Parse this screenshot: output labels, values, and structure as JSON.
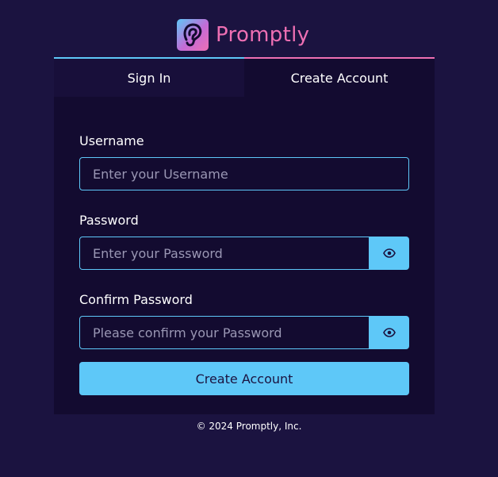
{
  "brand": {
    "name": "Promptly",
    "logo_icon": "ear-icon",
    "colors": {
      "pink": "#ee6fb3",
      "blue": "#5ec8f8",
      "background": "#1b1340",
      "card": "#130b30"
    }
  },
  "tabs": [
    {
      "label": "Sign In",
      "active": false
    },
    {
      "label": "Create Account",
      "active": true
    }
  ],
  "form": {
    "username": {
      "label": "Username",
      "placeholder": "Enter your Username",
      "value": ""
    },
    "password": {
      "label": "Password",
      "placeholder": "Enter your Password",
      "value": "",
      "toggle_icon": "eye-icon"
    },
    "confirm_password": {
      "label": "Confirm Password",
      "placeholder": "Please confirm your Password",
      "value": "",
      "toggle_icon": "eye-icon"
    },
    "submit_label": "Create Account"
  },
  "footer": {
    "copyright": "© 2024 Promptly, Inc."
  }
}
